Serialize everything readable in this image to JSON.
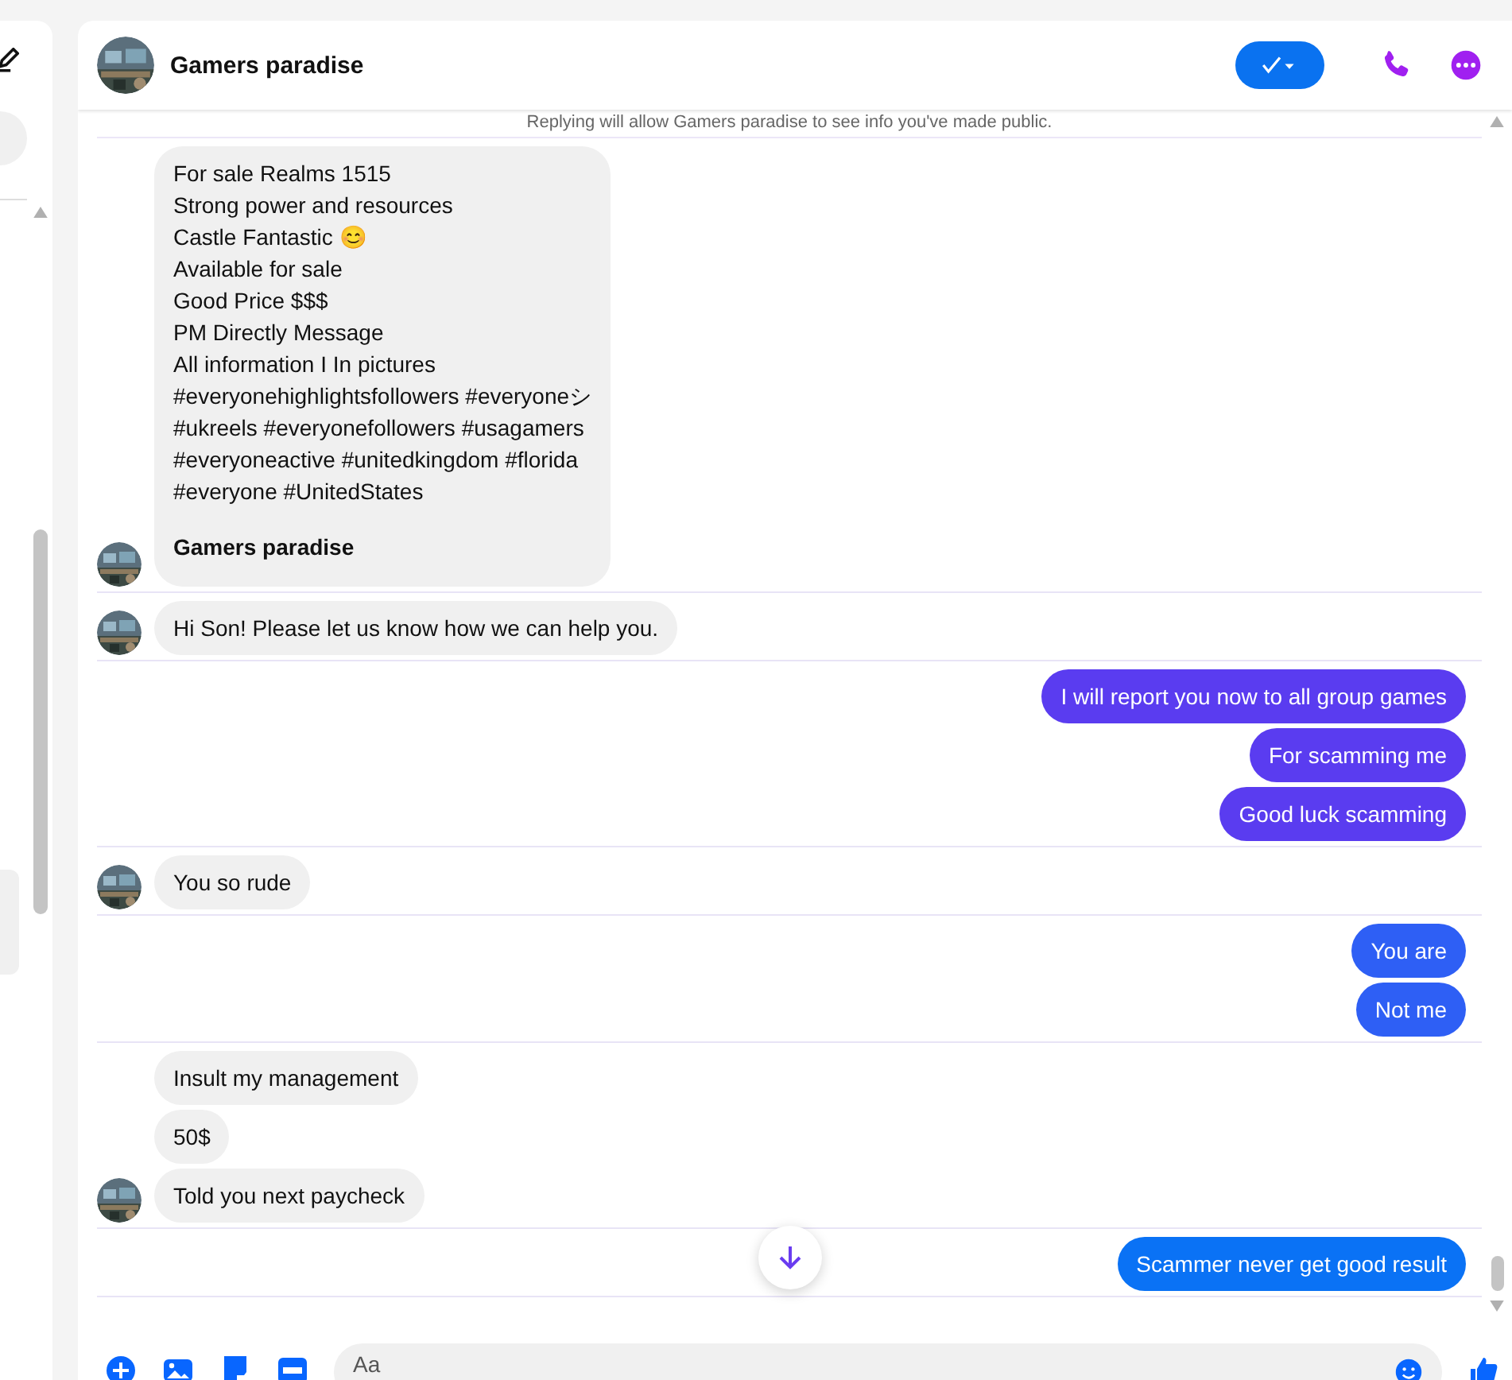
{
  "chat": {
    "title": "Gamers paradise",
    "notice": "Replying will allow Gamers paradise to see info you've made public."
  },
  "groups": [
    {
      "kind": "incoming",
      "messages": [
        {
          "text": "For sale Realms 1515\nStrong power and resources\nCastle Fantastic 😊\nAvailable for sale\nGood Price $$$\nPM Directly Message\nAll information I In pictures\n#everyonehighlightsfollowers #everyoneシ\n#ukreels #everyonefollowers #usagamers\n#everyoneactive #unitedkingdom #florida\n#everyone #UnitedStates",
          "signature": "Gamers paradise"
        }
      ]
    },
    {
      "kind": "incoming",
      "messages": [
        {
          "text": "Hi Son! Please let us know how we can help you."
        }
      ]
    },
    {
      "kind": "outgoing",
      "messages": [
        {
          "text": "I will report you now to all group games",
          "color": "#5a3cf0"
        },
        {
          "text": "For scamming me",
          "color": "#5a3cf0"
        },
        {
          "text": "Good luck scamming",
          "color": "#5a3cf0"
        }
      ]
    },
    {
      "kind": "incoming",
      "messages": [
        {
          "text": "You so rude"
        }
      ]
    },
    {
      "kind": "outgoing",
      "messages": [
        {
          "text": "You are",
          "color": "#2e5ff5"
        },
        {
          "text": "Not me",
          "color": "#2e5ff5"
        }
      ]
    },
    {
      "kind": "incoming",
      "messages": [
        {
          "text": "Insult my management"
        },
        {
          "text": "50$"
        },
        {
          "text": "Told you next paycheck"
        }
      ]
    },
    {
      "kind": "outgoing",
      "messages": [
        {
          "text": "Scammer never get good result",
          "color": "#0a72f5"
        }
      ]
    }
  ],
  "composer": {
    "placeholder": "Aa"
  }
}
